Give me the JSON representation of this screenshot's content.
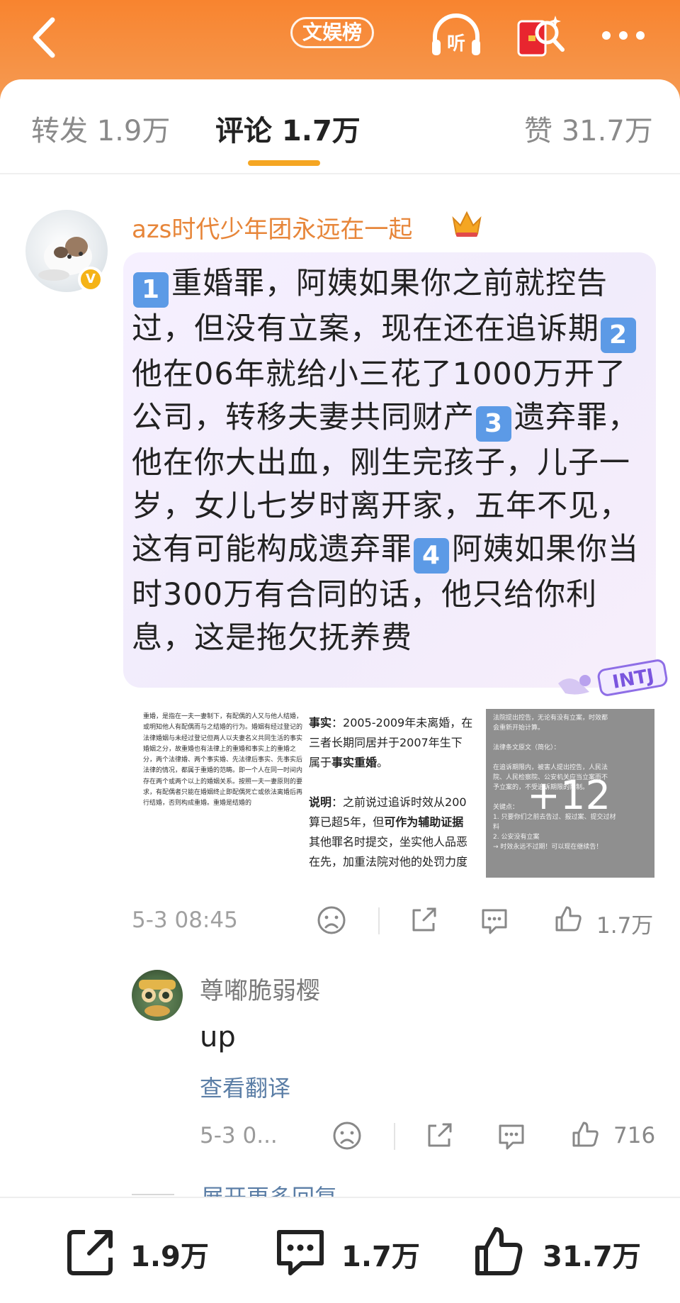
{
  "header": {
    "topic_label": "文娱榜",
    "listen_label": "听",
    "icons": [
      "back-arrow-icon",
      "headphones-listen-icon",
      "red-envelope-search-icon",
      "more-dots-icon"
    ],
    "colors": {
      "accent_orange": "#f8842f",
      "tab_underline": "#f5a623",
      "username": "#e7863a",
      "link": "#5b7ea6"
    }
  },
  "tabs": [
    {
      "label": "转发 1.9万"
    },
    {
      "label": "评论 1.7万"
    },
    {
      "label": "赞 31.7万"
    }
  ],
  "comment": {
    "username": "azs时代少年团永远在一起",
    "verified_badge": "V",
    "badge_label": "INTJ",
    "segments": [
      {
        "num": "1",
        "text": "重婚罪，阿姨如果你之前就控告过，但没有立案，现在还在追诉期"
      },
      {
        "num": "2",
        "text": "他在06年就给小三花了1000万开了公司，转移夫妻共同财产"
      },
      {
        "num": "3",
        "text": "遗弃罪，他在你大出血，刚生完孩子，儿子一岁，女儿七岁时离开家，五年不见，这有可能构成遗弃罪"
      },
      {
        "num": "4",
        "text": "阿姨如果你当时300万有合同的话，他只给你利息，这是拖欠抚养费"
      }
    ],
    "images": {
      "img1_text": "重婚，是指在一夫一妻制下，有配偶的人又与他人结婚，或明知他人有配偶而与之结婚的行为。婚姻有经过登记的法律婚姻与未经过登记但两人以夫妻名义共同生活的事实婚姻之分，故重婚也有法律上的重婚和事实上的重婚之分，两个法律婚、两个事实婚、先法律后事实、先事实后法律的情况，都属于重婚的范畴。即一个人在同一时间内存在两个或两个以上的婚姻关系。按照一夫一妻原则的要求，有配偶者只能在婚姻终止即配偶死亡或依法离婚后再行结婚，否则构成重婚。重婚是结婚的",
      "img2_lines": [
        {
          "bold": "事实",
          "text": "：2005-2009年未离婚，在"
        },
        {
          "bold": "",
          "text": "三者长期同居并于2007年生下"
        },
        {
          "bold": "",
          "text": "属于",
          "bold2": "事实重婚",
          "tail": "。"
        },
        {
          "bold": "",
          "text": ""
        },
        {
          "bold": "说明",
          "text": "：之前说过追诉时效从200"
        },
        {
          "bold": "",
          "text": "算已超5年，但",
          "bold2": "可作为辅助证据"
        },
        {
          "bold": "",
          "text": "其他罪名时提交，坐实他人品恶"
        },
        {
          "bold": "",
          "text": "在先，加重法院对他的处罚力度"
        }
      ],
      "img3_lines": [
        "法院提出控告，无论有没有立案，时效都",
        "会重新开始计算。",
        "",
        "法律条文原文（简化）：",
        "",
        "在追诉期限内，被害人提出控告，人民法",
        "院、人民检察院、公安机关应当立案而不",
        "予立案的，不受追诉期限的限制。",
        "",
        "关键点：",
        "1. 只要你们之前去告过、报过案、提交过材",
        "   料",
        "2. 公安没有立案",
        "   → 时效永远不过期！可以现在继续告！"
      ],
      "more_count": "+12"
    },
    "time": "5-3 08:45",
    "like_count": "1.7万"
  },
  "reply": {
    "username": "尊嘟脆弱樱",
    "text": "up",
    "translate_label": "查看翻译",
    "time": "5-3 0...",
    "like_count": "716"
  },
  "more_replies_label": "展开更多回复",
  "bottom_bar": {
    "repost_count": "1.9万",
    "comment_count": "1.7万",
    "like_count": "31.7万"
  }
}
